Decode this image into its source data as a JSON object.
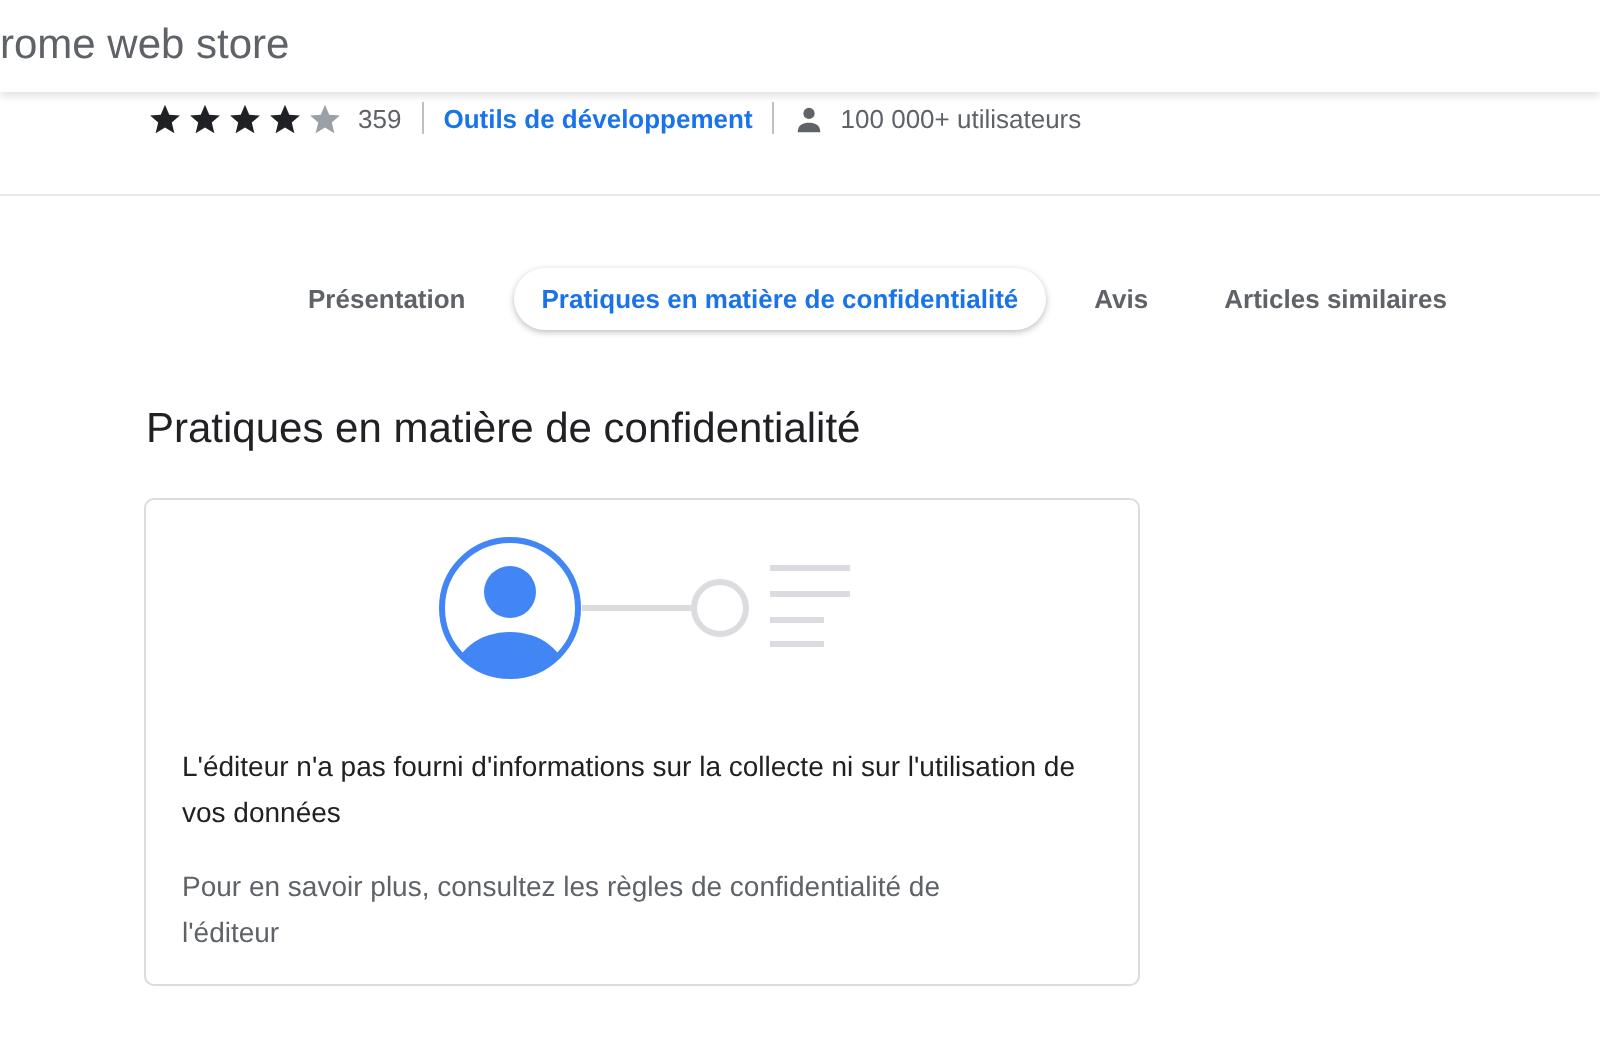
{
  "header": {
    "title": "rome web store"
  },
  "meta": {
    "stars": 4,
    "rating_count": "359",
    "category": "Outils de développement",
    "users": "100 000+ utilisateurs"
  },
  "tabs": [
    {
      "label": "Présentation",
      "selected": false
    },
    {
      "label": "Pratiques en matière de confidentialité",
      "selected": true
    },
    {
      "label": "Avis",
      "selected": false
    },
    {
      "label": "Articles similaires",
      "selected": false
    }
  ],
  "section": {
    "heading": "Pratiques en matière de confidentialité",
    "message": "L'éditeur n'a pas fourni d'informations sur la collecte ni sur l'utilisation de vos données",
    "note": "Pour en savoir plus, consultez les règles de confidentialité de l'éditeur"
  }
}
